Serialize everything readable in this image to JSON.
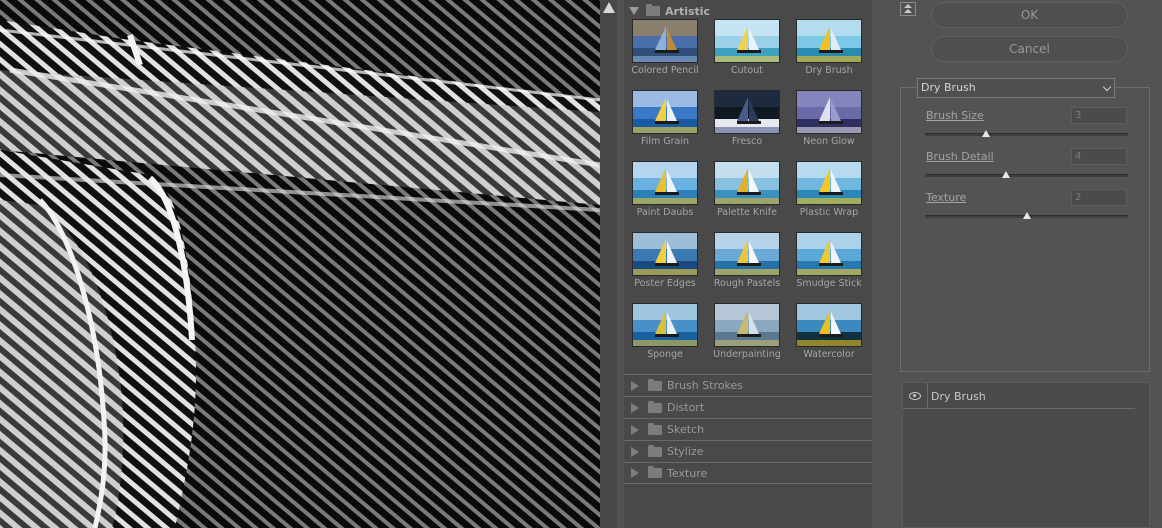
{
  "gallery": {
    "expanded_category": "Artistic",
    "thumbnails": [
      {
        "label": "Colored Pencil",
        "icon": "colored-pencil-thumbnail"
      },
      {
        "label": "Cutout",
        "icon": "cutout-thumbnail"
      },
      {
        "label": "Dry Brush",
        "icon": "dry-brush-thumbnail"
      },
      {
        "label": "Film Grain",
        "icon": "film-grain-thumbnail"
      },
      {
        "label": "Fresco",
        "icon": "fresco-thumbnail"
      },
      {
        "label": "Neon Glow",
        "icon": "neon-glow-thumbnail"
      },
      {
        "label": "Paint Daubs",
        "icon": "paint-daubs-thumbnail"
      },
      {
        "label": "Palette Knife",
        "icon": "palette-knife-thumbnail"
      },
      {
        "label": "Plastic Wrap",
        "icon": "plastic-wrap-thumbnail"
      },
      {
        "label": "Poster Edges",
        "icon": "poster-edges-thumbnail"
      },
      {
        "label": "Rough Pastels",
        "icon": "rough-pastels-thumbnail"
      },
      {
        "label": "Smudge Stick",
        "icon": "smudge-stick-thumbnail"
      },
      {
        "label": "Sponge",
        "icon": "sponge-thumbnail"
      },
      {
        "label": "Underpainting",
        "icon": "underpainting-thumbnail"
      },
      {
        "label": "Watercolor",
        "icon": "watercolor-thumbnail"
      }
    ],
    "collapsed_categories": [
      "Brush Strokes",
      "Distort",
      "Sketch",
      "Stylize",
      "Texture"
    ]
  },
  "dialog": {
    "ok_label": "OK",
    "cancel_label": "Cancel",
    "selected_filter": "Dry Brush",
    "params": [
      {
        "label": "Brush Size",
        "value": "3",
        "level": 0.3
      },
      {
        "label": "Brush Detail",
        "value": "4",
        "level": 0.4
      },
      {
        "label": "Texture",
        "value": "2",
        "level": 0.5
      }
    ]
  },
  "layers": {
    "active_layer": "Dry Brush"
  },
  "colors": {
    "panel_bg": "#535353",
    "gallery_bg": "#494949",
    "preview_bg": "#0b0b0b"
  }
}
